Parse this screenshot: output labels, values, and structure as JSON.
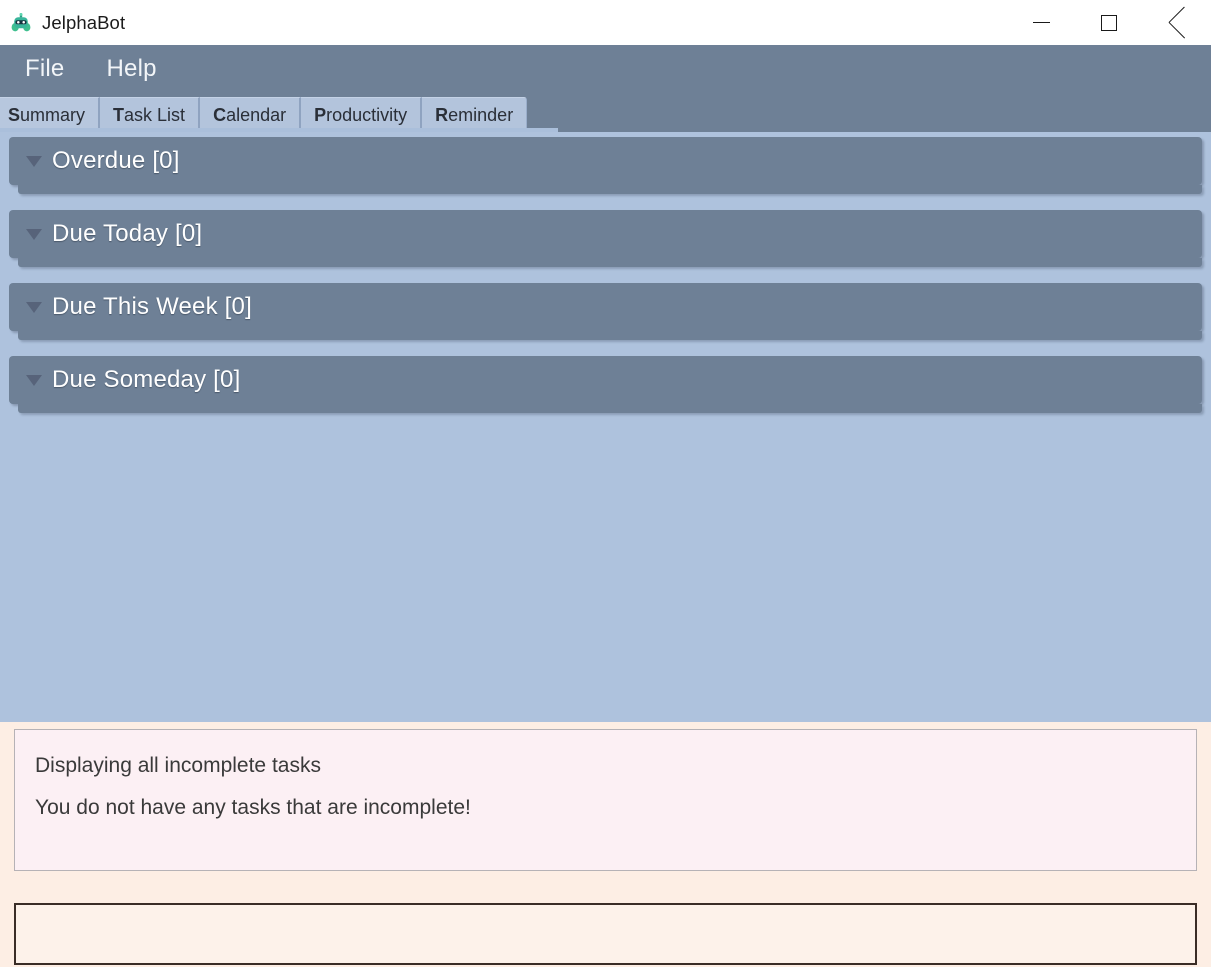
{
  "window": {
    "title": "JelphaBot",
    "icon": "robot-icon",
    "controls": {
      "minimize_label": "Minimize",
      "maximize_label": "Maximize",
      "close_label": "Close"
    }
  },
  "menubar": {
    "items": [
      {
        "label": "File",
        "mnemonic": "F"
      },
      {
        "label": "Help",
        "mnemonic": "H"
      }
    ]
  },
  "tabs": {
    "selected": "Summary",
    "items": [
      {
        "mnemonic": "S",
        "rest": "ummary",
        "label": "Summary"
      },
      {
        "mnemonic": "T",
        "rest": "ask List",
        "label": "Task List"
      },
      {
        "mnemonic": "C",
        "rest": "alendar",
        "label": "Calendar"
      },
      {
        "mnemonic": "P",
        "rest": "roductivity",
        "label": "Productivity"
      },
      {
        "mnemonic": "R",
        "rest": "eminder",
        "label": "Reminder"
      }
    ]
  },
  "summary": {
    "sections": [
      {
        "title": "Overdue [0]",
        "name": "overdue",
        "count": 0,
        "expanded": true
      },
      {
        "title": "Due Today [0]",
        "name": "due-today",
        "count": 0,
        "expanded": true
      },
      {
        "title": "Due This Week [0]",
        "name": "due-this-week",
        "count": 0,
        "expanded": true
      },
      {
        "title": "Due Someday [0]",
        "name": "due-someday",
        "count": 0,
        "expanded": true
      }
    ]
  },
  "status": {
    "line1": "Displaying all incomplete tasks",
    "line2": "You do not have any tasks that are incomplete!"
  },
  "command": {
    "value": "",
    "placeholder": ""
  },
  "colors": {
    "window_chrome": "#6e8096",
    "content_background": "#aec2dd",
    "tab_background": "#b3c4dc",
    "section_header": "#6e8096",
    "status_background": "#fdeee4",
    "message_box": "#fcf0f4",
    "input_border": "#3a2d27"
  }
}
